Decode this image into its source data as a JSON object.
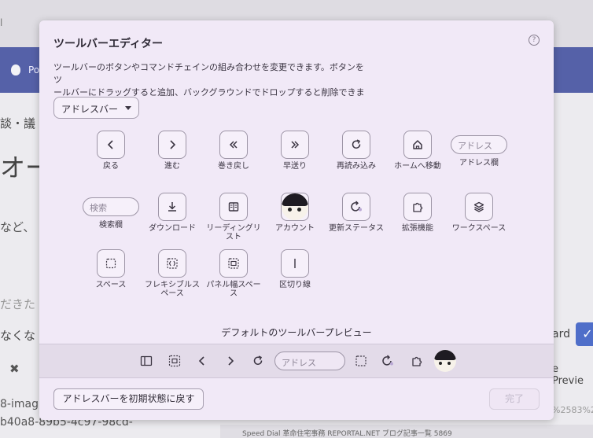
{
  "background": {
    "tab_text": "l",
    "nav_text": "Po",
    "line1": "談・議",
    "line2": "オー",
    "line3": "など、",
    "line4": "だきた",
    "line5": "なくな",
    "line7": "8-imag",
    "line8": "b40a8-89b5-4c97-98cd-",
    "right1": "ard",
    "right2": "e Previe",
    "right3": "%2583%2",
    "bottom_bar": "Speed Dial   革命住宅事務   REPORTAL.NET   ブログ記事一覧   5869"
  },
  "dialog": {
    "title": "ツールバーエディター",
    "help": "?",
    "description_line1": "ツールバーのボタンやコマンドチェインの組み合わせを変更できます。ボタンをツ",
    "description_line2": "ールバーにドラッグすると追加、バックグラウンドでドロップすると削除できます。",
    "toolbar_select": "アドレスバー",
    "items": {
      "back": "戻る",
      "forward": "進む",
      "rewind": "巻き戻し",
      "fast_forward": "早送り",
      "reload": "再読み込み",
      "home": "ホームへ移動",
      "address_field_label": "アドレス欄",
      "address_placeholder": "アドレス",
      "search_field_label": "検索欄",
      "search_placeholder": "検索",
      "download": "ダウンロード",
      "reading_list": "リーディングリスト",
      "account": "アカウント",
      "update_status": "更新ステータス",
      "extensions": "拡張機能",
      "workspaces": "ワークスペース",
      "space": "スペース",
      "flexible_space": "フレキシブルスペース",
      "panel_width_space": "パネル幅スペース",
      "separator": "区切り線"
    },
    "preview_title": "デフォルトのツールバープレビュー",
    "preview_address_placeholder": "アドレス",
    "reset_button": "アドレスバーを初期状態に戻す",
    "done_button": "完了"
  }
}
